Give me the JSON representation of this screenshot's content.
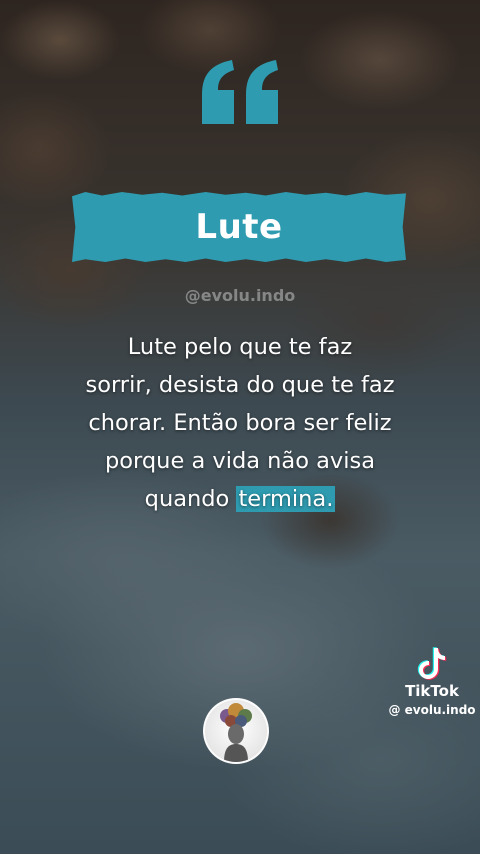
{
  "banner": {
    "title": "Lute"
  },
  "watermark": {
    "handle": "@evolu.indo"
  },
  "quote": {
    "lines": [
      "Lute pelo que te faz",
      "sorrir, desista do que te faz",
      "chorar. Então bora ser feliz",
      "porque a vida não avisa"
    ],
    "last_line_prefix": "quando ",
    "last_line_highlight": "termina."
  },
  "tiktok": {
    "brand": "TikTok",
    "handle": "@ evolu.indo"
  },
  "icons": {
    "quote": "quote-mark-icon",
    "tiktok": "tiktok-logo-icon",
    "avatar": "profile-avatar"
  },
  "colors": {
    "accent": "#2e9bb0",
    "text": "#ffffff"
  }
}
